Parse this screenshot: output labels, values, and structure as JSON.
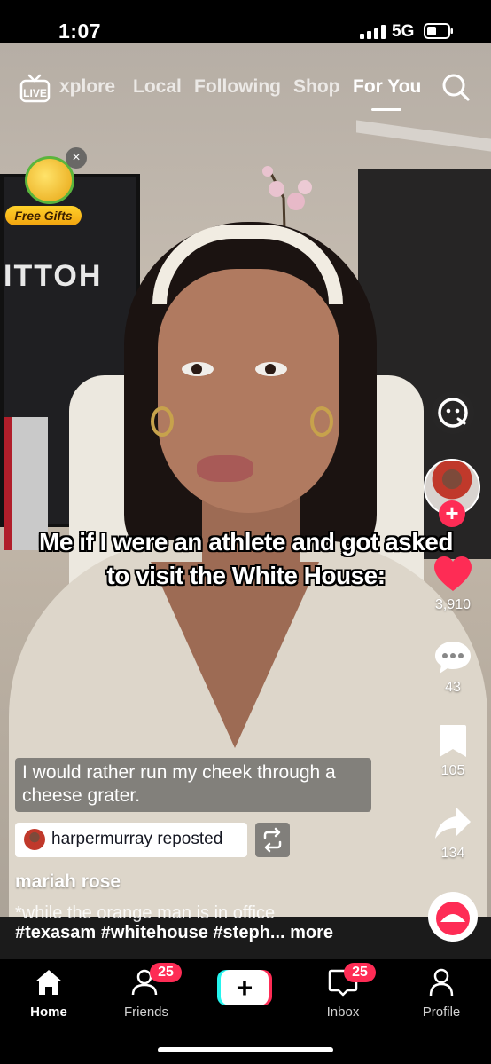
{
  "status_bar": {
    "time": "1:07",
    "network": "5G"
  },
  "top_nav": {
    "live_label": "LIVE",
    "tabs": [
      {
        "label": "xplore",
        "active": false
      },
      {
        "label": "Local",
        "active": false
      },
      {
        "label": "Following",
        "active": false
      },
      {
        "label": "Shop",
        "active": false
      },
      {
        "label": "For You",
        "active": true
      }
    ]
  },
  "free_gifts": {
    "label": "Free Gifts",
    "close": "×"
  },
  "video": {
    "overlay_caption": "Me if I were an athlete and got asked to visit the White House:",
    "background_text": "ITTOH"
  },
  "actions": {
    "likes": "3,910",
    "comments": "43",
    "saves": "105",
    "shares": "134",
    "follow_plus": "+"
  },
  "post": {
    "comment_text": "I would rather run my cheek through a cheese grater.",
    "repost_label": "harpermurray reposted",
    "author": "mariah rose",
    "description": "*while the orange man is in office",
    "hashtags": "#texasam #whitehouse #steph... more"
  },
  "bottom_nav": {
    "items": [
      {
        "label": "Home",
        "active": true
      },
      {
        "label": "Friends",
        "badge": "25"
      },
      {
        "label": "",
        "create": true
      },
      {
        "label": "Inbox",
        "badge": "25"
      },
      {
        "label": "Profile"
      }
    ],
    "create_plus": "+"
  },
  "colors": {
    "accent": "#fe2c55",
    "bg": "#000000",
    "gift_gold": "#ffd22b"
  }
}
